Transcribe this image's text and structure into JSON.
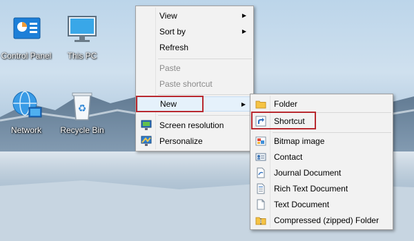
{
  "desktop": {
    "icons": [
      {
        "label": "Control Panel",
        "icon": "control-panel-icon"
      },
      {
        "label": "This PC",
        "icon": "monitor-icon"
      },
      {
        "label": "Network",
        "icon": "network-globe-icon"
      },
      {
        "label": "Recycle Bin",
        "icon": "recycle-bin-icon"
      }
    ]
  },
  "context_menu": {
    "items": [
      {
        "label": "View",
        "submenu": true
      },
      {
        "label": "Sort by",
        "submenu": true
      },
      {
        "label": "Refresh"
      },
      {
        "label": "Paste",
        "disabled": true
      },
      {
        "label": "Paste shortcut",
        "disabled": true
      },
      {
        "label": "New",
        "submenu": true,
        "active": true
      },
      {
        "label": "Screen resolution",
        "icon": "screen-resolution-icon"
      },
      {
        "label": "Personalize",
        "icon": "personalize-icon"
      }
    ]
  },
  "new_submenu": {
    "items": [
      {
        "label": "Folder",
        "icon": "folder-icon"
      },
      {
        "label": "Shortcut",
        "icon": "shortcut-icon",
        "highlighted": true
      },
      {
        "label": "Bitmap image",
        "icon": "bitmap-image-icon"
      },
      {
        "label": "Contact",
        "icon": "contact-icon"
      },
      {
        "label": "Journal Document",
        "icon": "journal-document-icon"
      },
      {
        "label": "Rich Text Document",
        "icon": "rich-text-document-icon"
      },
      {
        "label": "Text Document",
        "icon": "text-document-icon"
      },
      {
        "label": "Compressed (zipped) Folder",
        "icon": "zipped-folder-icon"
      }
    ]
  },
  "colors": {
    "highlight_box": "#b8282e",
    "menu_hover": "#e5f1fb"
  }
}
